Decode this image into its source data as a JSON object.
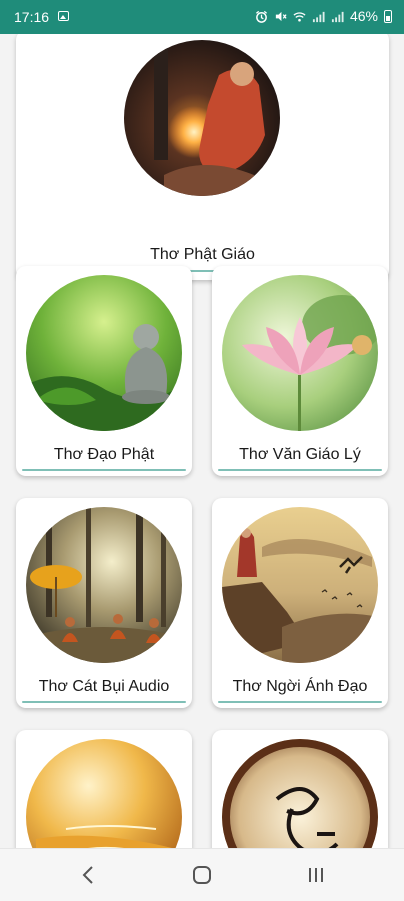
{
  "status_bar": {
    "time": "17:16",
    "battery": "46%",
    "icons": [
      "image-icon",
      "alarm-icon",
      "mute-icon",
      "wifi-icon",
      "signal-icon",
      "signal-icon",
      "battery-icon"
    ]
  },
  "cards": [
    {
      "title": "Thơ Phật Giáo",
      "icon": "buddha-candle-image"
    },
    {
      "title": "Thơ Đạo Phật",
      "icon": "buddha-statue-image"
    },
    {
      "title": "Thơ Văn Giáo Lý",
      "icon": "lotus-image"
    },
    {
      "title": "Thơ Cát Bụi Audio",
      "icon": "monks-forest-image"
    },
    {
      "title": "Thơ Ngời Ánh Đạo",
      "icon": "monk-cliff-image"
    },
    {
      "title": "",
      "icon": "golden-buddha-image"
    },
    {
      "title": "",
      "icon": "calligraphy-image"
    }
  ],
  "colors": {
    "accent": "#1f8c7a",
    "underline": "#7fbfb6",
    "background": "#f3f3f3"
  },
  "nav": {
    "back": "back-icon",
    "home": "home-icon",
    "recents": "recents-icon"
  }
}
